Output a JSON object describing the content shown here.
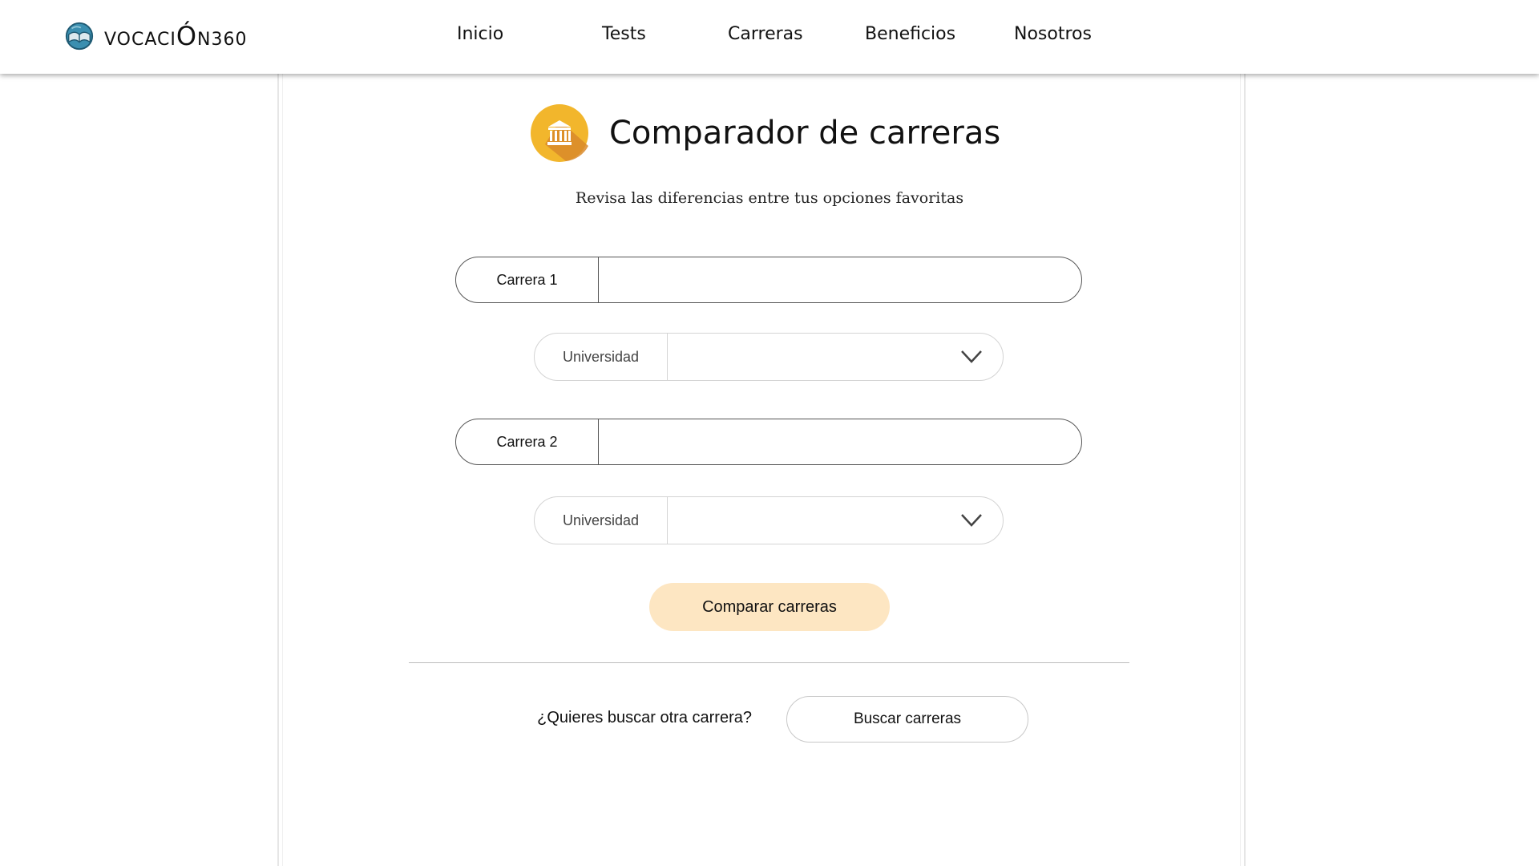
{
  "header": {
    "logo_text_prefix": "VOCACI",
    "logo_text_big": "Ó",
    "logo_text_suffix": "N360",
    "logo_icon": "globe-book-icon",
    "nav": [
      {
        "label": "Inicio"
      },
      {
        "label": "Tests"
      },
      {
        "label": "Carreras"
      },
      {
        "label": "Beneficios"
      },
      {
        "label": "Nosotros"
      }
    ]
  },
  "main": {
    "title_icon": "bank-building-icon",
    "title": "Comparador de carreras",
    "subtitle": "Revisa las diferencias entre tus opciones favoritas",
    "career1": {
      "label": "Carrera 1",
      "value": ""
    },
    "university1": {
      "label": "Universidad",
      "selected": ""
    },
    "career2": {
      "label": "Carrera 2",
      "value": ""
    },
    "university2": {
      "label": "Universidad",
      "selected": ""
    },
    "compare_button": "Comparar carreras",
    "search_prompt": "¿Quieres buscar otra carrera?",
    "search_button": "Buscar carreras"
  },
  "colors": {
    "accent_button": "#fde6c2",
    "icon_circle": "#f2b62c",
    "icon_shadow": "#d9892a"
  }
}
